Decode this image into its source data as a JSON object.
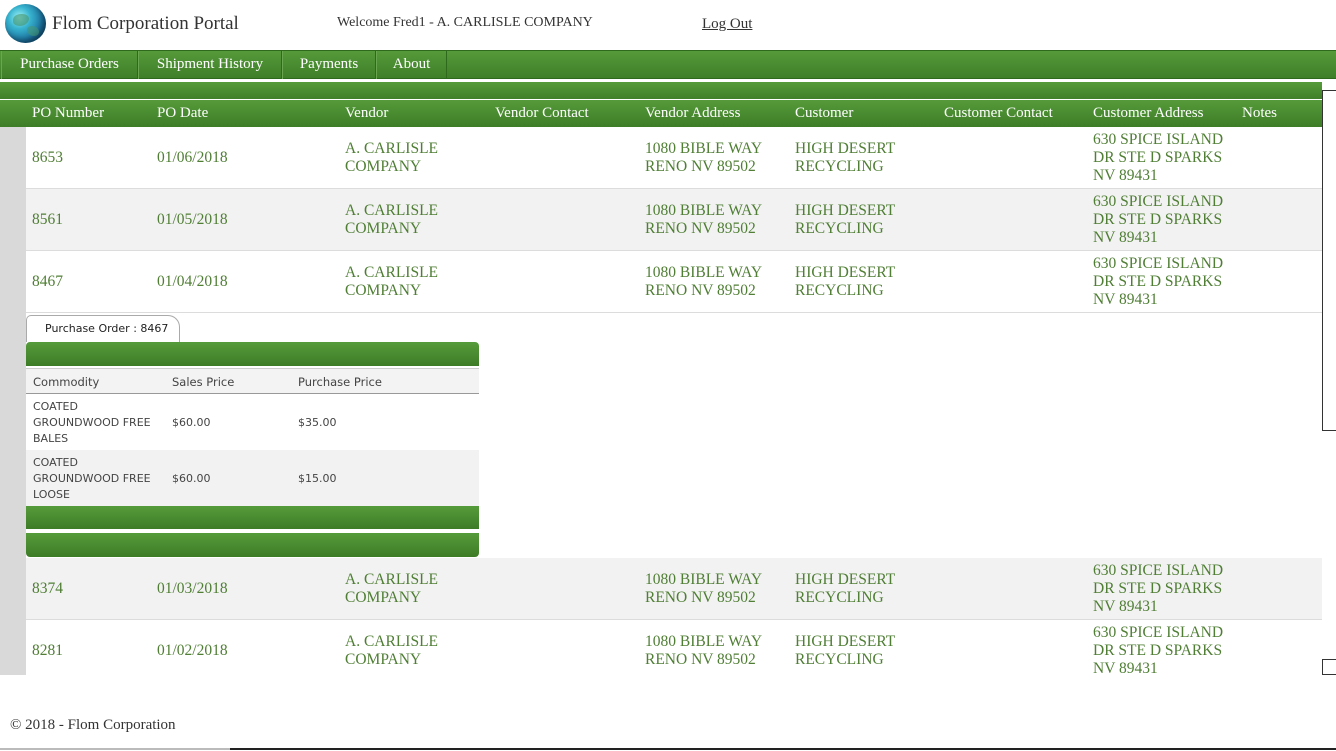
{
  "header": {
    "site_title": "Flom Corporation Portal",
    "welcome_text": "Welcome Fred1 - A. CARLISLE COMPANY",
    "logout_label": "Log Out"
  },
  "nav": {
    "items": [
      "Purchase Orders",
      "Shipment History",
      "Payments",
      "About"
    ]
  },
  "grid": {
    "columns": [
      "PO Number",
      "PO Date",
      "Vendor",
      "Vendor Contact",
      "Vendor Address",
      "Customer",
      "Customer Contact",
      "Customer Address",
      "Notes"
    ],
    "rows": [
      {
        "po": "8653",
        "date": "01/06/2018",
        "vendor": "A. CARLISLE COMPANY",
        "vendor_contact": "",
        "vendor_address": "1080 BIBLE WAY RENO NV 89502",
        "customer": "HIGH DESERT RECYCLING",
        "customer_contact": "",
        "customer_address": "630 SPICE ISLAND DR STE D SPARKS NV 89431",
        "notes": ""
      },
      {
        "po": "8561",
        "date": "01/05/2018",
        "vendor": "A. CARLISLE COMPANY",
        "vendor_contact": "",
        "vendor_address": "1080 BIBLE WAY RENO NV 89502",
        "customer": "HIGH DESERT RECYCLING",
        "customer_contact": "",
        "customer_address": "630 SPICE ISLAND DR STE D SPARKS NV 89431",
        "notes": ""
      },
      {
        "po": "8467",
        "date": "01/04/2018",
        "vendor": "A. CARLISLE COMPANY",
        "vendor_contact": "",
        "vendor_address": "1080 BIBLE WAY RENO NV 89502",
        "customer": "HIGH DESERT RECYCLING",
        "customer_contact": "",
        "customer_address": "630 SPICE ISLAND DR STE D SPARKS NV 89431",
        "notes": ""
      },
      {
        "po": "8374",
        "date": "01/03/2018",
        "vendor": "A. CARLISLE COMPANY",
        "vendor_contact": "",
        "vendor_address": "1080 BIBLE WAY RENO NV 89502",
        "customer": "HIGH DESERT RECYCLING",
        "customer_contact": "",
        "customer_address": "630 SPICE ISLAND DR STE D SPARKS NV 89431",
        "notes": ""
      },
      {
        "po": "8281",
        "date": "01/02/2018",
        "vendor": "A. CARLISLE COMPANY",
        "vendor_contact": "",
        "vendor_address": "1080 BIBLE WAY RENO NV 89502",
        "customer": "HIGH DESERT RECYCLING",
        "customer_contact": "",
        "customer_address": "630 SPICE ISLAND DR STE D SPARKS NV 89431",
        "notes": ""
      }
    ]
  },
  "detail": {
    "tab_label": "Purchase Order : 8467",
    "columns": [
      "Commodity",
      "Sales Price",
      "Purchase Price"
    ],
    "rows": [
      {
        "commodity": "COATED GROUNDWOOD FREE BALES",
        "sales_price": "$60.00",
        "purchase_price": "$35.00"
      },
      {
        "commodity": "COATED GROUNDWOOD FREE LOOSE",
        "sales_price": "$60.00",
        "purchase_price": "$15.00"
      }
    ]
  },
  "footer": {
    "text": "© 2018 - Flom Corporation"
  },
  "colors": {
    "brand_green": "#4a8c31",
    "cell_text_green": "#4f7e34",
    "row_alt": "#f2f2f2"
  }
}
